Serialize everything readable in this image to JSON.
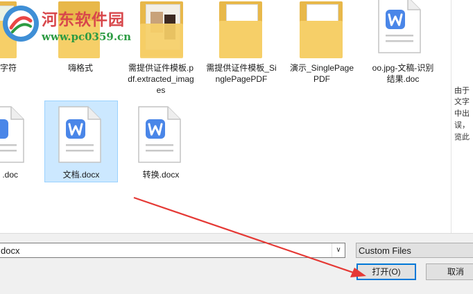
{
  "watermark": {
    "title": "河东软件园",
    "url": "www.pc0359.cn"
  },
  "files": {
    "row1": [
      {
        "label": "字符",
        "type": "folder"
      },
      {
        "label": "嗨格式",
        "type": "folder"
      },
      {
        "label": "需提供证件模板.pdf.extracted_images",
        "type": "folder"
      },
      {
        "label": "需提供证件模板_SinglePagePDF",
        "type": "folder"
      },
      {
        "label": "演示_SinglePagePDF",
        "type": "folder"
      },
      {
        "label": "oo.jpg-文稿-识别结果.doc",
        "type": "word"
      }
    ],
    "row2": [
      {
        "label": ".doc",
        "type": "word"
      },
      {
        "label": "文档.docx",
        "type": "word",
        "selected": true
      },
      {
        "label": "转换.docx",
        "type": "word"
      }
    ]
  },
  "preview_text": [
    "由于",
    "文字",
    "中出",
    "误，",
    "览此"
  ],
  "filename_field": {
    "value": "docx"
  },
  "filetype_select": {
    "value": "Custom Files"
  },
  "buttons": {
    "open": "打开(O)",
    "cancel": "取消"
  },
  "colors": {
    "word_blue": "#4a86e8",
    "selection": "#cce8ff",
    "annotation_arrow": "#e53935",
    "primary_border": "#0078d7"
  }
}
